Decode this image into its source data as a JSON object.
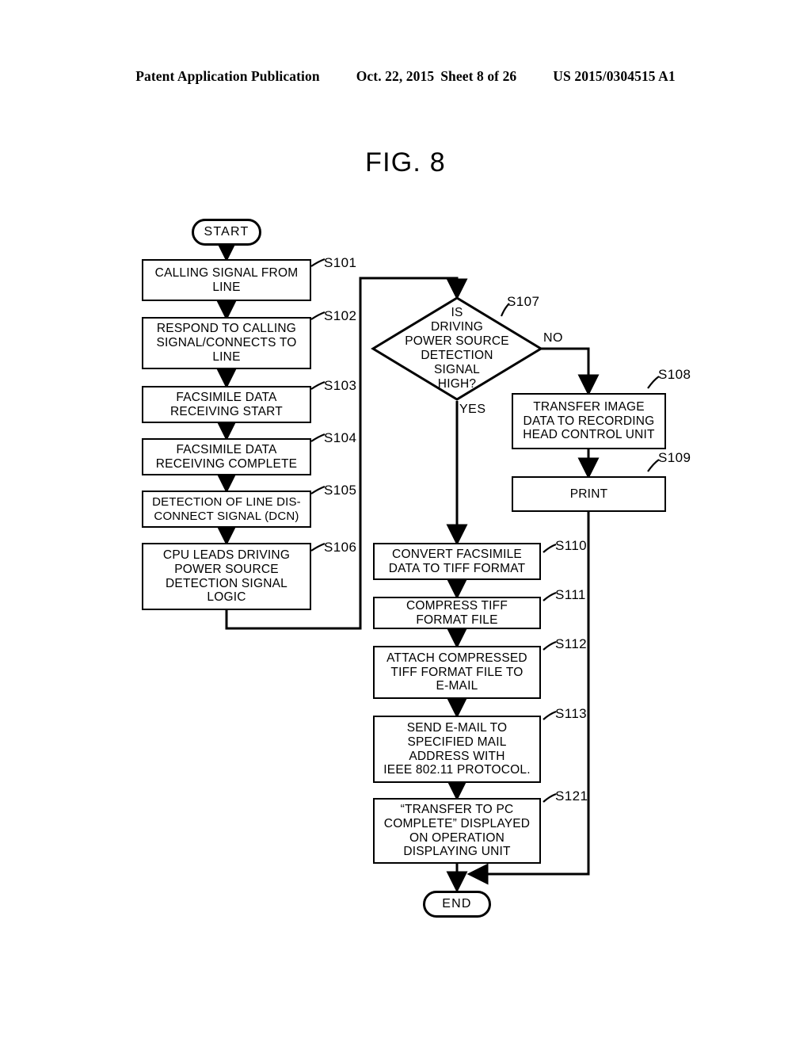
{
  "header": {
    "publication": "Patent Application Publication",
    "date": "Oct. 22, 2015",
    "sheet": "Sheet 8 of 26",
    "patent_number": "US 2015/0304515 A1"
  },
  "figure": {
    "title": "FIG. 8"
  },
  "flowchart": {
    "start_label": "START",
    "end_label": "END",
    "branch_yes": "YES",
    "branch_no": "NO",
    "steps": [
      {
        "id": "S101",
        "text": "CALLING SIGNAL FROM\nLINE"
      },
      {
        "id": "S102",
        "text": "RESPOND TO CALLING\nSIGNAL/CONNECTS TO\nLINE"
      },
      {
        "id": "S103",
        "text": "FACSIMILE DATA\nRECEIVING START"
      },
      {
        "id": "S104",
        "text": "FACSIMILE DATA\nRECEIVING COMPLETE"
      },
      {
        "id": "S105",
        "text": "DETECTION OF LINE DIS-\nCONNECT SIGNAL (DCN)"
      },
      {
        "id": "S106",
        "text": "CPU LEADS DRIVING\nPOWER SOURCE\nDETECTION SIGNAL\nLOGIC"
      },
      {
        "id": "S107",
        "text": "IS\nDRIVING\nPOWER SOURCE\nDETECTION\nSIGNAL\nHIGH?"
      },
      {
        "id": "S108",
        "text": "TRANSFER IMAGE\nDATA TO RECORDING\nHEAD CONTROL UNIT"
      },
      {
        "id": "S109",
        "text": "PRINT"
      },
      {
        "id": "S110",
        "text": "CONVERT FACSIMILE\nDATA TO TIFF FORMAT"
      },
      {
        "id": "S111",
        "text": "COMPRESS TIFF\nFORMAT FILE"
      },
      {
        "id": "S112",
        "text": "ATTACH COMPRESSED\nTIFF FORMAT FILE TO\nE-MAIL"
      },
      {
        "id": "S113",
        "text": "SEND E-MAIL TO\nSPECIFIED MAIL\nADDRESS WITH\nIEEE 802.11 PROTOCOL."
      },
      {
        "id": "S121",
        "text": "“TRANSFER TO PC\nCOMPLETE” DISPLAYED\nON OPERATION\nDISPLAYING UNIT"
      }
    ]
  },
  "colors": {
    "ink": "#000000",
    "paper": "#ffffff"
  }
}
